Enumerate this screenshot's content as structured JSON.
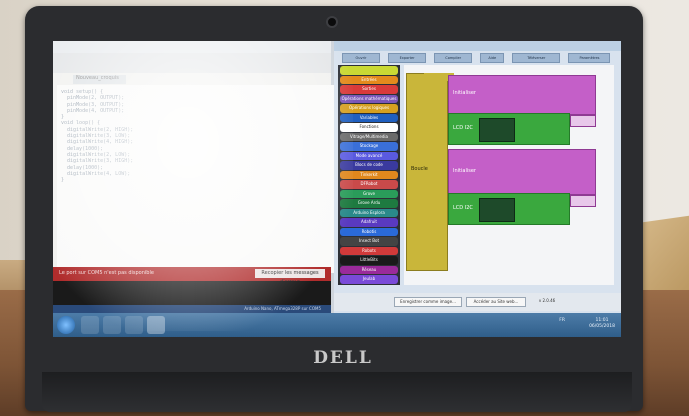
{
  "ide": {
    "tab_label": "Nouveau_croquis",
    "code_lines": [
      "void setup() {",
      "  pinMode(2, OUTPUT);",
      "  pinMode(3, OUTPUT);",
      "  pinMode(4, OUTPUT);",
      "}",
      "",
      "void loop() {",
      "  digitalWrite(2, HIGH);",
      "  digitalWrite(3, LOW);",
      "  digitalWrite(4, HIGH);",
      "  delay(1000);",
      "  digitalWrite(2, LOW);",
      "  digitalWrite(3, HIGH);",
      "  delay(1000);",
      "  digitalWrite(4, LOW);",
      "}"
    ],
    "error_message": "Le port sur COM5 n'est pas disponible",
    "copy_button": "Recopier les messages d'erreur",
    "console_lines": [
      "   ",
      "   "
    ],
    "status_text": "Arduino Nano, ATmega328P sur COM5"
  },
  "app": {
    "toolbar_buttons": [
      "Ouvrir",
      "Exporter",
      "Compiler",
      "Aide",
      "Téléverser",
      "Paramètres"
    ],
    "palette_items": [
      {
        "label": "",
        "color": "#c9d934"
      },
      {
        "label": "Entrées",
        "color": "#e38a1d"
      },
      {
        "label": "Sorties",
        "color": "#d93a3a"
      },
      {
        "label": "Opérations mathématiques",
        "color": "#7a56b8"
      },
      {
        "label": "Opérations logiques",
        "color": "#d5a020"
      },
      {
        "label": "Variables",
        "color": "#1f5fbf"
      },
      {
        "label": "Fonctions",
        "color": "#ffffff"
      },
      {
        "label": "Vitrage/Multimedia",
        "color": "#6a6a6a"
      },
      {
        "label": "Stockage",
        "color": "#3a6fd8"
      },
      {
        "label": "Mode avancé",
        "color": "#5a5ae0"
      },
      {
        "label": "Blocs de code",
        "color": "#3a3a9f"
      },
      {
        "label": "Tinkerkit",
        "color": "#e0881d"
      },
      {
        "label": "DFRobot",
        "color": "#c94a4a"
      },
      {
        "label": "Grove",
        "color": "#2a9c5a"
      },
      {
        "label": "Grove Ardu",
        "color": "#1e7a40"
      },
      {
        "label": "Arduino Esplora",
        "color": "#2a8a8a"
      },
      {
        "label": "Adafruit",
        "color": "#5a3ac0"
      },
      {
        "label": "Robotis",
        "color": "#2a6ad8"
      },
      {
        "label": "Insect Bot",
        "color": "#444444"
      },
      {
        "label": "Robots",
        "color": "#d13a3a"
      },
      {
        "label": "LittleBits",
        "color": "#1a1a1a"
      },
      {
        "label": "Réseau",
        "color": "#9a2a9a"
      },
      {
        "label": "Jeulab",
        "color": "#7a4ad8"
      }
    ],
    "blocks": {
      "main_label": "Boucle",
      "top_text": "Initialiser",
      "top_value": "",
      "mid_text": "LCD I2C",
      "bottom_text": "Initialiser",
      "lower_text": "LCD I2C"
    },
    "footer_buttons": [
      "Enregistrer comme image...",
      "Accéder au Site web..."
    ],
    "version": "v 2.0.46"
  },
  "taskbar": {
    "time": "11:01",
    "date": "06/05/2018",
    "lang": "FR"
  },
  "device": {
    "brand": "DELL"
  }
}
